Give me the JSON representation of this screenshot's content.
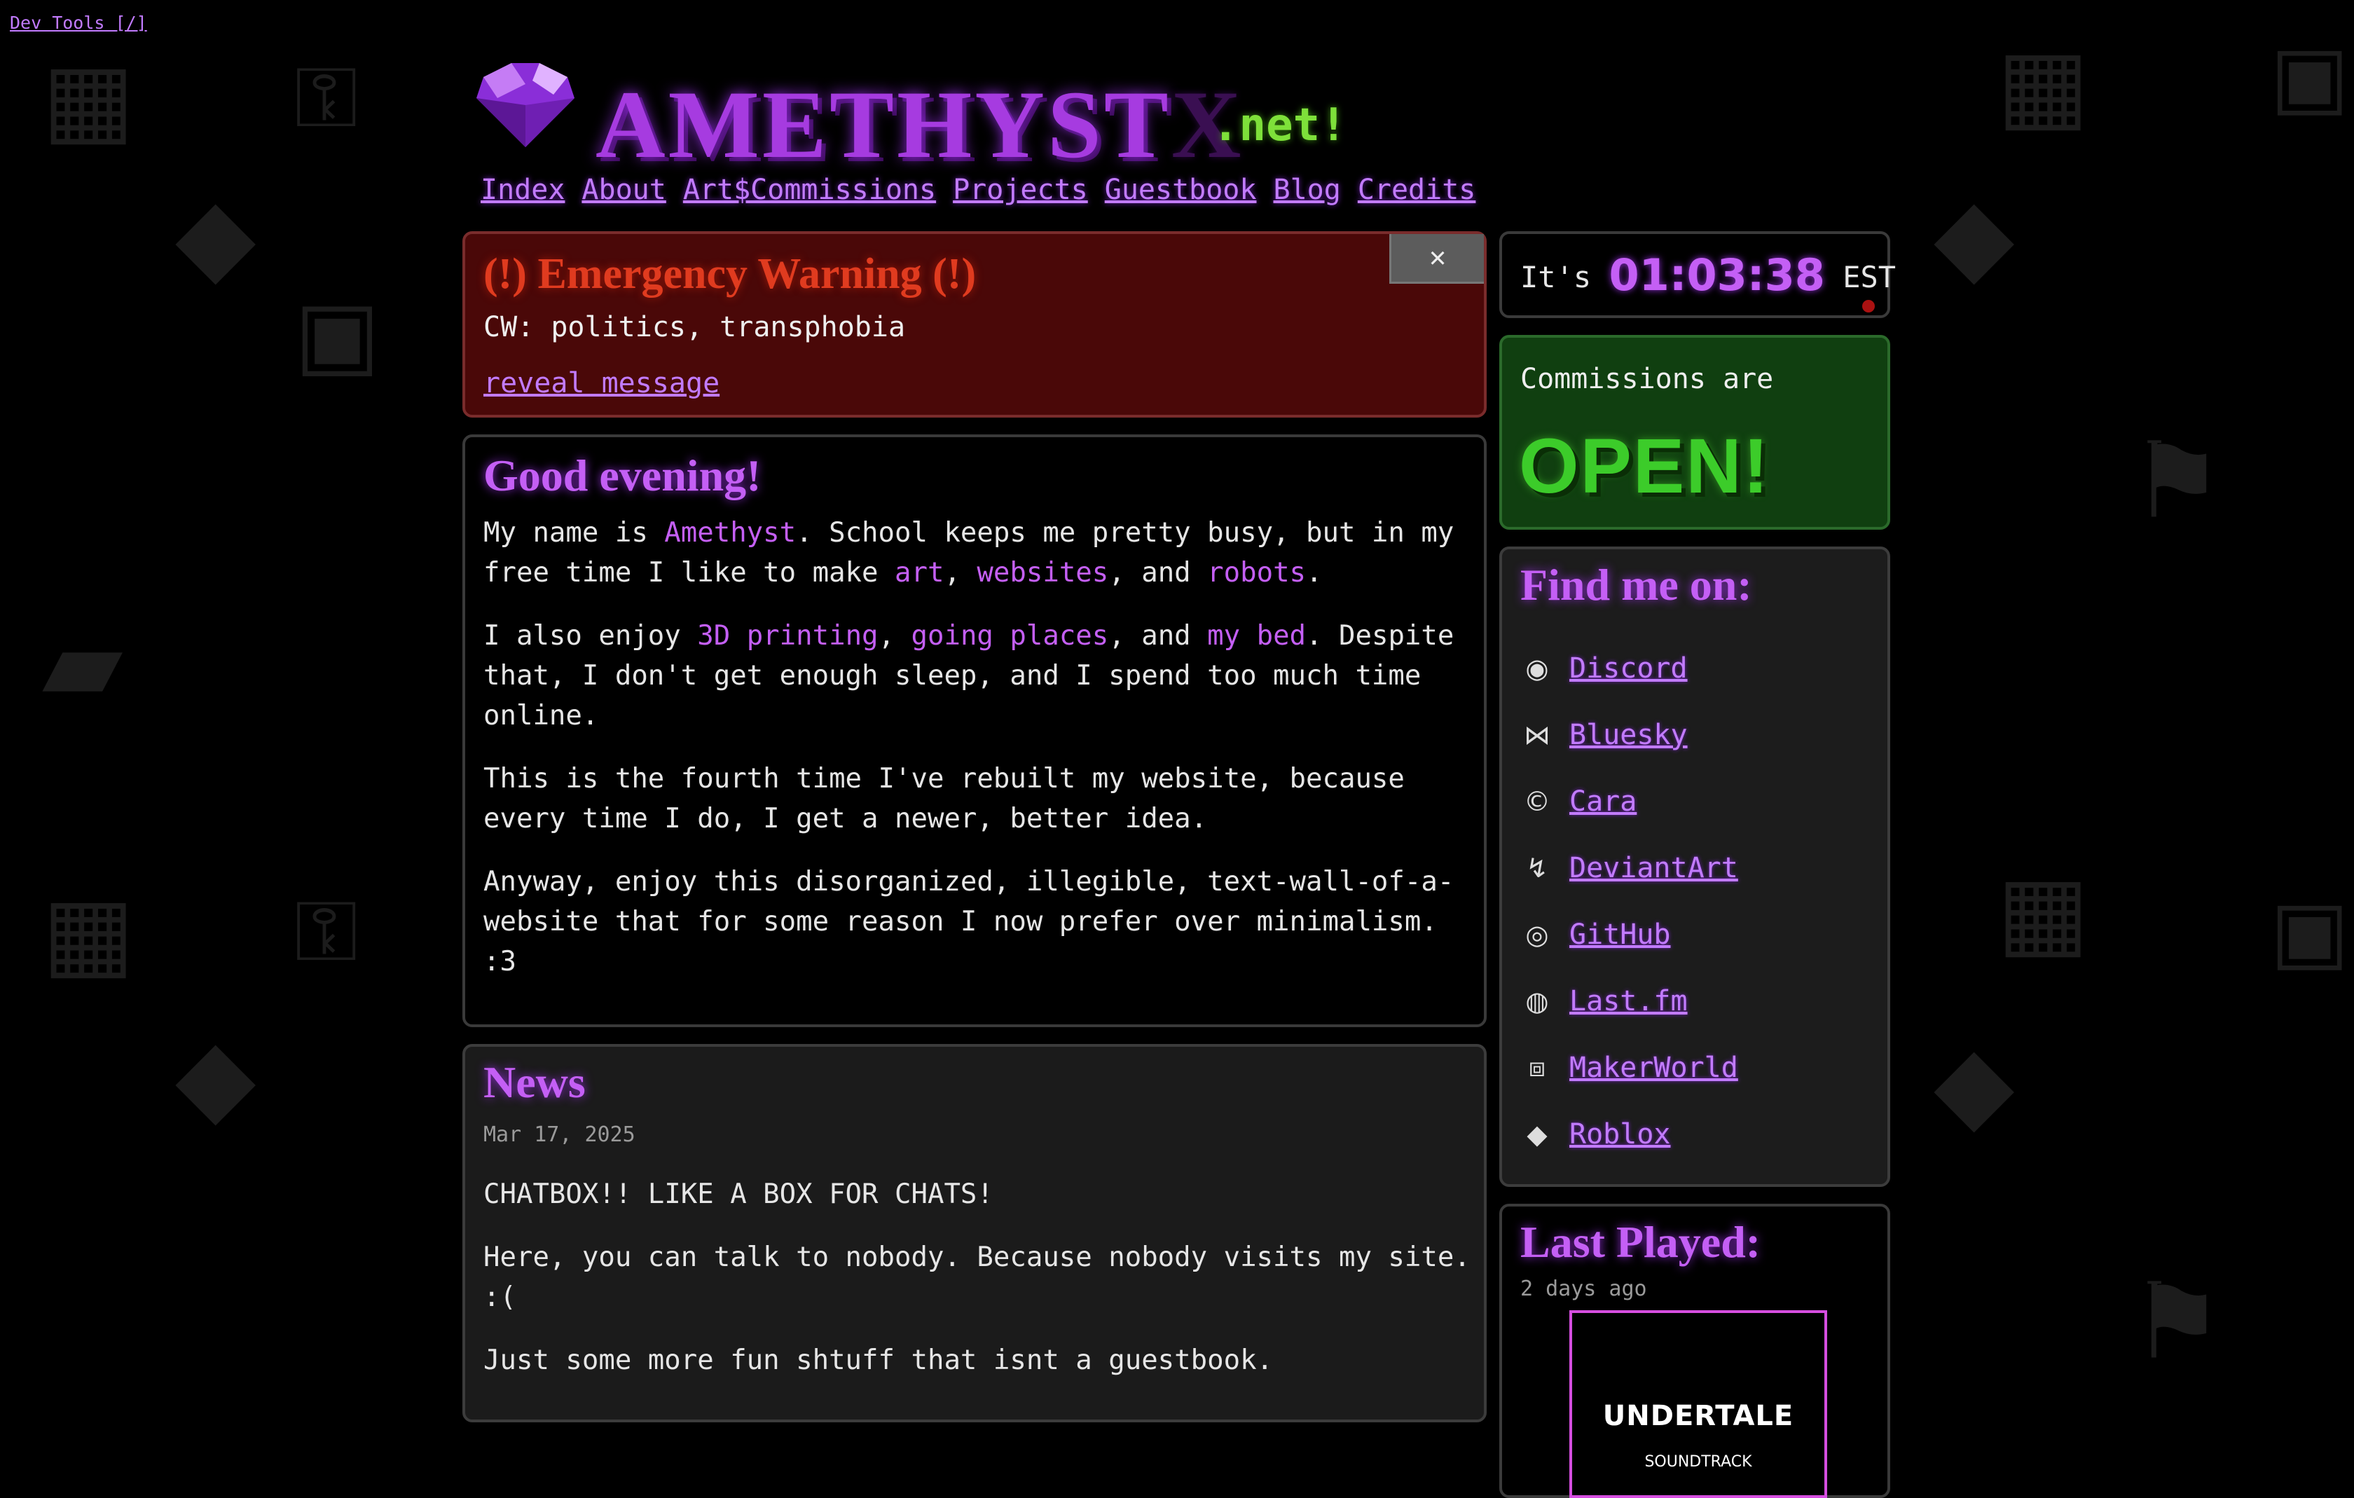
{
  "dev_tools": "Dev Tools [/]",
  "logo": {
    "word_main": "AMETHYST",
    "word_dim": "X",
    "tld": ".net!"
  },
  "nav": [
    "Index",
    "About",
    "Art$Commissions",
    "Projects",
    "Guestbook",
    "Blog",
    "Credits"
  ],
  "warning": {
    "close": "✕",
    "title": "(!) Emergency Warning (!)",
    "cw": "CW: politics, transphobia",
    "link": "reveal message"
  },
  "intro": {
    "heading": "Good evening!",
    "p1": {
      "a": "My name is ",
      "name": "Amethyst",
      "b": ". School keeps me pretty busy, but in my free time I like to make ",
      "art": "art",
      "c": ", ",
      "websites": "websites",
      "d": ", and ",
      "robots": "robots",
      "e": "."
    },
    "p2": {
      "a": "I also enjoy ",
      "printing": "3D printing",
      "b": ", ",
      "places": "going places",
      "c": ", and ",
      "bed": "my bed",
      "d": ". Despite that, I don't get enough sleep, and I spend too much time online."
    },
    "p3": "This is the fourth time I've rebuilt my website, because every time I do, I get a newer, better idea.",
    "p4": "Anyway, enjoy this disorganized, illegible, text-wall-of-a-website that for some reason I now prefer over minimalism. :3"
  },
  "news": {
    "heading": "News",
    "date": "Mar 17, 2025",
    "p1": "CHATBOX!! LIKE A BOX FOR CHATS!",
    "p2": "Here, you can talk to nobody. Because nobody visits my site. :(",
    "p3": "Just some more fun shtuff that isnt a guestbook."
  },
  "clock": {
    "prefix": "It's",
    "time": "01:03:38",
    "zone": "EST"
  },
  "commissions": {
    "lead": "Commissions are",
    "status": "OPEN!"
  },
  "find": {
    "heading": "Find me on:",
    "links": [
      {
        "label": "Discord",
        "icon": "discord-icon",
        "glyph": "◉"
      },
      {
        "label": "Bluesky",
        "icon": "butterfly-icon",
        "glyph": "⋈"
      },
      {
        "label": "Cara",
        "icon": "cara-icon",
        "glyph": "©"
      },
      {
        "label": "DeviantArt",
        "icon": "deviantart-icon",
        "glyph": "↯"
      },
      {
        "label": "GitHub",
        "icon": "github-icon",
        "glyph": "◎"
      },
      {
        "label": "Last.fm",
        "icon": "lastfm-icon",
        "glyph": "◍"
      },
      {
        "label": "MakerWorld",
        "icon": "makerworld-icon",
        "glyph": "⧈"
      },
      {
        "label": "Roblox",
        "icon": "roblox-icon",
        "glyph": "◆"
      }
    ]
  },
  "last_played": {
    "heading": "Last Played:",
    "ago": "2 days ago",
    "album_title": "UNDERTALE",
    "album_sub": "SOUNDTRACK"
  }
}
